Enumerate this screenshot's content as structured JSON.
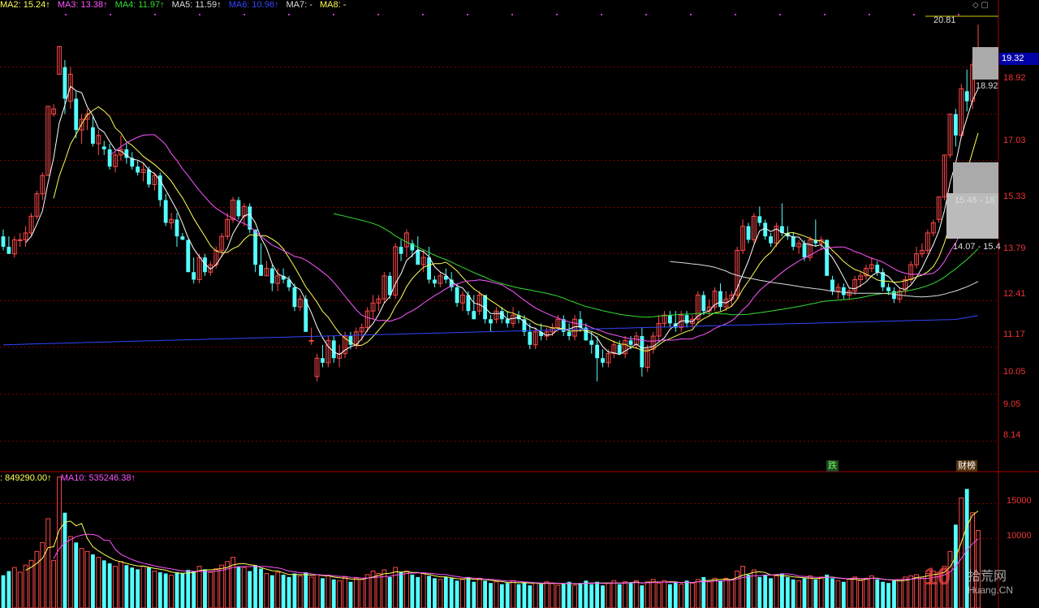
{
  "ma_legend": [
    {
      "label": "MA2: 15.24↑",
      "color": "#ffff55"
    },
    {
      "label": "MA3: 13.38↑",
      "color": "#ff55ff"
    },
    {
      "label": "MA4: 11.97↑",
      "color": "#33dd33"
    },
    {
      "label": "MA5: 11.59↑",
      "color": "#dddddd"
    },
    {
      "label": "MA6: 10.96↑",
      "color": "#3344ff"
    },
    {
      "label": "MA7: -",
      "color": "#dddddd"
    },
    {
      "label": "MA8: -",
      "color": "#ffff55"
    }
  ],
  "vol_legend": [
    {
      "label": ": 849290.00↑",
      "color": "#ffff55"
    },
    {
      "label": "MA10: 535246.38↑",
      "color": "#ff55ff"
    }
  ],
  "price_axis_labels": [
    "18.92",
    "17.03",
    "15.33",
    "13.79",
    "12.41",
    "11.17",
    "10.05",
    "9.05",
    "8.14"
  ],
  "current_price": "19.32",
  "max_price_note": "20.81",
  "close_note": "18.92",
  "chip_note_1": "15.48 - 16",
  "chip_note_2": "14.07 - 15.4",
  "vol_axis_labels": [
    "15000",
    "10000"
  ],
  "markers": [
    {
      "text": "跌",
      "color": "#66ff66",
      "bg": "#224422"
    },
    {
      "text": "财榜",
      "color": "#ffffff",
      "bg": "#553311"
    }
  ],
  "watermark": {
    "logo": "10",
    "text": "拾荒网",
    "sub": "Huang.CN"
  },
  "colors": {
    "up": "#ff4a4a",
    "down": "#54ffff",
    "grid": "#7a0000",
    "limit_up": "#ff66ff",
    "limit_down": "#22dd22"
  },
  "chart_data": {
    "type": "candlestick",
    "price_scale": "log",
    "ylim": [
      7.6,
      21.2
    ],
    "candles": [
      [
        12.9,
        13.1,
        12.5,
        12.6
      ],
      [
        12.6,
        12.9,
        12.4,
        12.4
      ],
      [
        12.4,
        12.9,
        12.3,
        12.8
      ],
      [
        12.8,
        13.0,
        12.6,
        12.8
      ],
      [
        12.8,
        13.2,
        12.6,
        13.0
      ],
      [
        13.0,
        13.6,
        12.9,
        13.5
      ],
      [
        13.5,
        14.3,
        13.4,
        14.2
      ],
      [
        14.2,
        14.9,
        14.0,
        14.8
      ],
      [
        14.8,
        17.3,
        14.8,
        17.3
      ],
      [
        17.0,
        17.4,
        16.9,
        17.2
      ],
      [
        18.6,
        19.8,
        18.6,
        19.8
      ],
      [
        18.9,
        19.2,
        17.0,
        17.6
      ],
      [
        17.5,
        18.9,
        17.2,
        18.6
      ],
      [
        17.6,
        17.9,
        16.1,
        16.4
      ],
      [
        16.4,
        17.0,
        15.9,
        16.8
      ],
      [
        16.8,
        17.2,
        16.4,
        17.0
      ],
      [
        16.5,
        16.9,
        15.8,
        15.9
      ],
      [
        15.9,
        16.4,
        15.5,
        16.2
      ],
      [
        15.8,
        16.0,
        15.5,
        15.7
      ],
      [
        15.7,
        15.9,
        15.0,
        15.1
      ],
      [
        15.1,
        15.6,
        14.9,
        15.5
      ],
      [
        15.5,
        16.2,
        15.3,
        15.7
      ],
      [
        15.7,
        15.9,
        15.2,
        15.4
      ],
      [
        15.4,
        15.6,
        15.0,
        15.1
      ],
      [
        15.1,
        15.3,
        14.8,
        14.9
      ],
      [
        14.9,
        15.2,
        14.6,
        15.0
      ],
      [
        15.0,
        15.1,
        14.4,
        14.5
      ],
      [
        14.5,
        14.9,
        14.3,
        14.8
      ],
      [
        14.8,
        14.9,
        13.8,
        14.0
      ],
      [
        14.0,
        14.2,
        13.2,
        13.3
      ],
      [
        13.3,
        13.6,
        13.1,
        13.4
      ],
      [
        13.4,
        13.6,
        12.6,
        12.9
      ],
      [
        12.9,
        13.0,
        12.8,
        12.8
      ],
      [
        12.8,
        12.8,
        11.9,
        11.9
      ],
      [
        11.9,
        12.3,
        11.6,
        11.7
      ],
      [
        11.7,
        12.4,
        11.6,
        12.3
      ],
      [
        12.3,
        12.4,
        11.8,
        11.9
      ],
      [
        11.9,
        12.2,
        11.8,
        12.1
      ],
      [
        12.1,
        12.6,
        12.0,
        12.5
      ],
      [
        12.5,
        13.0,
        12.3,
        12.9
      ],
      [
        12.9,
        13.6,
        12.8,
        13.4
      ],
      [
        13.4,
        14.1,
        13.3,
        14.0
      ],
      [
        14.0,
        14.1,
        13.4,
        13.5
      ],
      [
        13.5,
        13.9,
        13.2,
        13.8
      ],
      [
        13.8,
        13.9,
        13.0,
        13.1
      ],
      [
        13.1,
        13.1,
        11.9,
        12.1
      ],
      [
        12.1,
        12.7,
        11.8,
        11.8
      ],
      [
        11.8,
        12.2,
        11.8,
        12.0
      ],
      [
        12.0,
        12.1,
        11.4,
        11.6
      ],
      [
        11.6,
        12.0,
        11.4,
        11.8
      ],
      [
        11.8,
        12.0,
        11.6,
        11.7
      ],
      [
        11.7,
        11.8,
        11.4,
        11.5
      ],
      [
        11.5,
        11.6,
        10.9,
        11.0
      ],
      [
        11.0,
        11.3,
        10.9,
        11.2
      ],
      [
        11.2,
        11.3,
        10.4,
        10.4
      ],
      [
        10.2,
        10.5,
        10.1,
        10.2
      ],
      [
        9.4,
        9.9,
        9.3,
        9.8
      ],
      [
        9.8,
        10.1,
        9.6,
        9.7
      ],
      [
        9.7,
        10.3,
        9.6,
        10.2
      ],
      [
        10.2,
        10.3,
        9.7,
        9.8
      ],
      [
        9.8,
        10.1,
        9.6,
        9.9
      ],
      [
        9.9,
        10.4,
        9.8,
        10.3
      ],
      [
        10.3,
        10.4,
        10.0,
        10.1
      ],
      [
        10.1,
        10.5,
        10.0,
        10.4
      ],
      [
        10.4,
        10.6,
        10.2,
        10.5
      ],
      [
        10.5,
        11.0,
        10.4,
        10.9
      ],
      [
        10.9,
        11.3,
        10.7,
        11.1
      ],
      [
        11.1,
        11.3,
        10.9,
        11.2
      ],
      [
        11.2,
        11.9,
        11.1,
        11.8
      ],
      [
        11.8,
        11.9,
        11.2,
        11.3
      ],
      [
        11.3,
        12.7,
        11.2,
        12.6
      ],
      [
        12.6,
        12.8,
        12.2,
        12.4
      ],
      [
        12.6,
        13.1,
        12.3,
        13.0
      ],
      [
        12.7,
        12.8,
        12.3,
        12.5
      ],
      [
        12.5,
        12.9,
        12.1,
        12.1
      ],
      [
        12.1,
        12.5,
        11.9,
        12.3
      ],
      [
        12.3,
        12.6,
        11.6,
        11.7
      ],
      [
        11.7,
        11.8,
        11.5,
        11.6
      ],
      [
        11.6,
        11.9,
        11.5,
        11.8
      ],
      [
        11.8,
        12.0,
        11.6,
        11.7
      ],
      [
        11.7,
        11.9,
        11.4,
        11.5
      ],
      [
        11.5,
        11.6,
        11.0,
        11.1
      ],
      [
        11.1,
        11.4,
        10.9,
        11.3
      ],
      [
        11.3,
        11.4,
        10.8,
        10.9
      ],
      [
        10.9,
        11.3,
        10.7,
        10.7
      ],
      [
        10.9,
        11.4,
        10.8,
        11.3
      ],
      [
        11.3,
        11.3,
        10.6,
        10.7
      ],
      [
        10.7,
        10.8,
        10.4,
        10.6
      ],
      [
        10.7,
        11.0,
        10.6,
        10.9
      ],
      [
        10.9,
        11.0,
        10.6,
        10.7
      ],
      [
        10.7,
        10.9,
        10.5,
        10.6
      ],
      [
        10.6,
        11.0,
        10.5,
        10.8
      ],
      [
        10.8,
        10.9,
        10.6,
        10.7
      ],
      [
        10.7,
        10.8,
        10.3,
        10.4
      ],
      [
        10.4,
        10.6,
        10.0,
        10.1
      ],
      [
        10.1,
        10.5,
        10.0,
        10.4
      ],
      [
        10.4,
        10.6,
        10.2,
        10.3
      ],
      [
        10.3,
        10.5,
        10.2,
        10.4
      ],
      [
        10.4,
        10.6,
        10.3,
        10.5
      ],
      [
        10.5,
        10.8,
        10.4,
        10.7
      ],
      [
        10.7,
        10.8,
        10.3,
        10.4
      ],
      [
        10.4,
        10.6,
        10.2,
        10.3
      ],
      [
        10.3,
        10.8,
        10.2,
        10.7
      ],
      [
        10.7,
        10.9,
        10.4,
        10.5
      ],
      [
        10.5,
        10.6,
        10.2,
        10.2
      ],
      [
        10.2,
        10.4,
        9.9,
        10.1
      ],
      [
        10.1,
        10.3,
        9.3,
        9.8
      ],
      [
        9.8,
        10.0,
        9.6,
        9.7
      ],
      [
        9.7,
        10.0,
        9.6,
        9.9
      ],
      [
        9.9,
        10.2,
        9.8,
        10.1
      ],
      [
        10.1,
        10.2,
        9.9,
        9.9
      ],
      [
        9.9,
        10.3,
        9.8,
        10.2
      ],
      [
        10.2,
        10.3,
        10.0,
        10.1
      ],
      [
        10.1,
        10.4,
        10.0,
        10.3
      ],
      [
        10.3,
        10.5,
        9.4,
        9.6
      ],
      [
        9.6,
        10.1,
        9.5,
        10.0
      ],
      [
        10.0,
        10.4,
        9.9,
        10.3
      ],
      [
        10.3,
        10.8,
        10.2,
        10.6
      ],
      [
        10.6,
        10.9,
        10.5,
        10.8
      ],
      [
        10.8,
        10.9,
        10.5,
        10.6
      ],
      [
        10.6,
        10.9,
        10.4,
        10.5
      ],
      [
        10.5,
        10.9,
        10.4,
        10.8
      ],
      [
        10.8,
        10.9,
        10.5,
        10.6
      ],
      [
        10.6,
        10.8,
        10.5,
        10.7
      ],
      [
        10.7,
        11.4,
        10.6,
        11.3
      ],
      [
        11.3,
        11.4,
        10.8,
        10.9
      ],
      [
        10.9,
        11.2,
        10.8,
        11.0
      ],
      [
        11.0,
        11.5,
        10.9,
        11.4
      ],
      [
        11.4,
        11.6,
        10.9,
        11.0
      ],
      [
        11.0,
        11.4,
        10.9,
        11.2
      ],
      [
        11.2,
        11.4,
        11.0,
        11.3
      ],
      [
        11.3,
        12.6,
        11.2,
        12.5
      ],
      [
        12.5,
        13.4,
        12.4,
        13.2
      ],
      [
        13.2,
        13.3,
        12.7,
        12.8
      ],
      [
        12.8,
        13.6,
        12.7,
        13.5
      ],
      [
        13.5,
        13.8,
        13.2,
        13.3
      ],
      [
        13.3,
        13.4,
        12.8,
        12.9
      ],
      [
        12.9,
        13.0,
        12.6,
        12.7
      ],
      [
        12.7,
        13.3,
        12.6,
        13.2
      ],
      [
        13.2,
        13.9,
        12.9,
        13.0
      ],
      [
        13.0,
        13.2,
        12.8,
        12.9
      ],
      [
        12.9,
        13.0,
        12.5,
        12.6
      ],
      [
        12.6,
        12.8,
        12.4,
        12.7
      ],
      [
        12.7,
        12.8,
        12.2,
        12.3
      ],
      [
        12.3,
        12.9,
        12.2,
        12.8
      ],
      [
        12.8,
        13.4,
        12.6,
        12.7
      ],
      [
        12.7,
        12.9,
        12.5,
        12.8
      ],
      [
        12.8,
        12.8,
        11.8,
        11.8
      ],
      [
        11.7,
        11.8,
        11.3,
        11.4
      ],
      [
        11.4,
        11.6,
        11.2,
        11.5
      ],
      [
        11.5,
        11.6,
        11.2,
        11.3
      ],
      [
        11.3,
        11.5,
        11.2,
        11.4
      ],
      [
        11.4,
        11.8,
        11.3,
        11.7
      ],
      [
        11.7,
        11.9,
        11.5,
        11.8
      ],
      [
        11.8,
        12.1,
        11.7,
        12.0
      ],
      [
        12.0,
        12.3,
        11.9,
        12.1
      ],
      [
        12.1,
        12.2,
        11.8,
        11.9
      ],
      [
        11.9,
        12.0,
        11.4,
        11.5
      ],
      [
        11.5,
        11.6,
        11.3,
        11.4
      ],
      [
        11.4,
        11.5,
        11.1,
        11.2
      ],
      [
        11.2,
        11.5,
        11.1,
        11.4
      ],
      [
        11.4,
        11.8,
        11.3,
        11.7
      ],
      [
        11.7,
        12.2,
        11.6,
        12.1
      ],
      [
        12.1,
        12.6,
        12.0,
        12.4
      ],
      [
        12.4,
        12.7,
        12.3,
        12.5
      ],
      [
        12.5,
        13.1,
        12.4,
        13.0
      ],
      [
        13.0,
        13.4,
        12.9,
        13.3
      ],
      [
        13.4,
        14.1,
        13.3,
        14.1
      ],
      [
        14.1,
        15.5,
        14.0,
        15.5
      ],
      [
        15.5,
        17.0,
        15.4,
        17.0
      ],
      [
        17.0,
        17.2,
        15.8,
        16.2
      ],
      [
        16.2,
        18.2,
        16.1,
        18.0
      ],
      [
        17.9,
        18.8,
        17.1,
        17.5
      ],
      [
        17.5,
        19.2,
        17.2,
        19.0
      ],
      [
        19.2,
        20.8,
        18.9,
        19.3
      ]
    ],
    "volume_ticks": [
      15000,
      10000
    ],
    "volume": [
      55,
      62,
      68,
      60,
      72,
      80,
      95,
      110,
      150,
      80,
      220,
      160,
      120,
      110,
      100,
      95,
      90,
      85,
      80,
      75,
      70,
      78,
      72,
      68,
      65,
      70,
      68,
      62,
      60,
      58,
      55,
      60,
      58,
      64,
      62,
      70,
      65,
      60,
      66,
      72,
      78,
      85,
      70,
      68,
      62,
      72,
      66,
      58,
      55,
      60,
      56,
      52,
      58,
      54,
      60,
      52,
      56,
      50,
      54,
      48,
      46,
      52,
      44,
      50,
      48,
      56,
      62,
      58,
      64,
      52,
      68,
      60,
      62,
      56,
      52,
      58,
      54,
      50,
      48,
      52,
      50,
      46,
      48,
      52,
      44,
      50,
      46,
      42,
      44,
      40,
      42,
      46,
      40,
      44,
      38,
      42,
      40,
      44,
      42,
      38,
      40,
      44,
      38,
      42,
      46,
      40,
      44,
      38,
      42,
      46,
      40,
      44,
      42,
      46,
      38,
      44,
      48,
      42,
      46,
      40,
      44,
      40,
      46,
      42,
      48,
      52,
      44,
      50,
      46,
      50,
      48,
      62,
      70,
      56,
      64,
      52,
      56,
      50,
      54,
      58,
      52,
      48,
      46,
      50,
      54,
      48,
      52,
      56,
      50,
      46,
      44,
      48,
      52,
      46,
      50,
      54,
      48,
      44,
      42,
      46,
      48,
      52,
      54,
      56,
      50,
      58,
      62,
      60,
      70,
      95,
      140,
      185,
      200,
      160,
      130
    ],
    "ma_lines": [
      "MA2",
      "MA3",
      "MA4",
      "MA5",
      "MA6"
    ]
  }
}
